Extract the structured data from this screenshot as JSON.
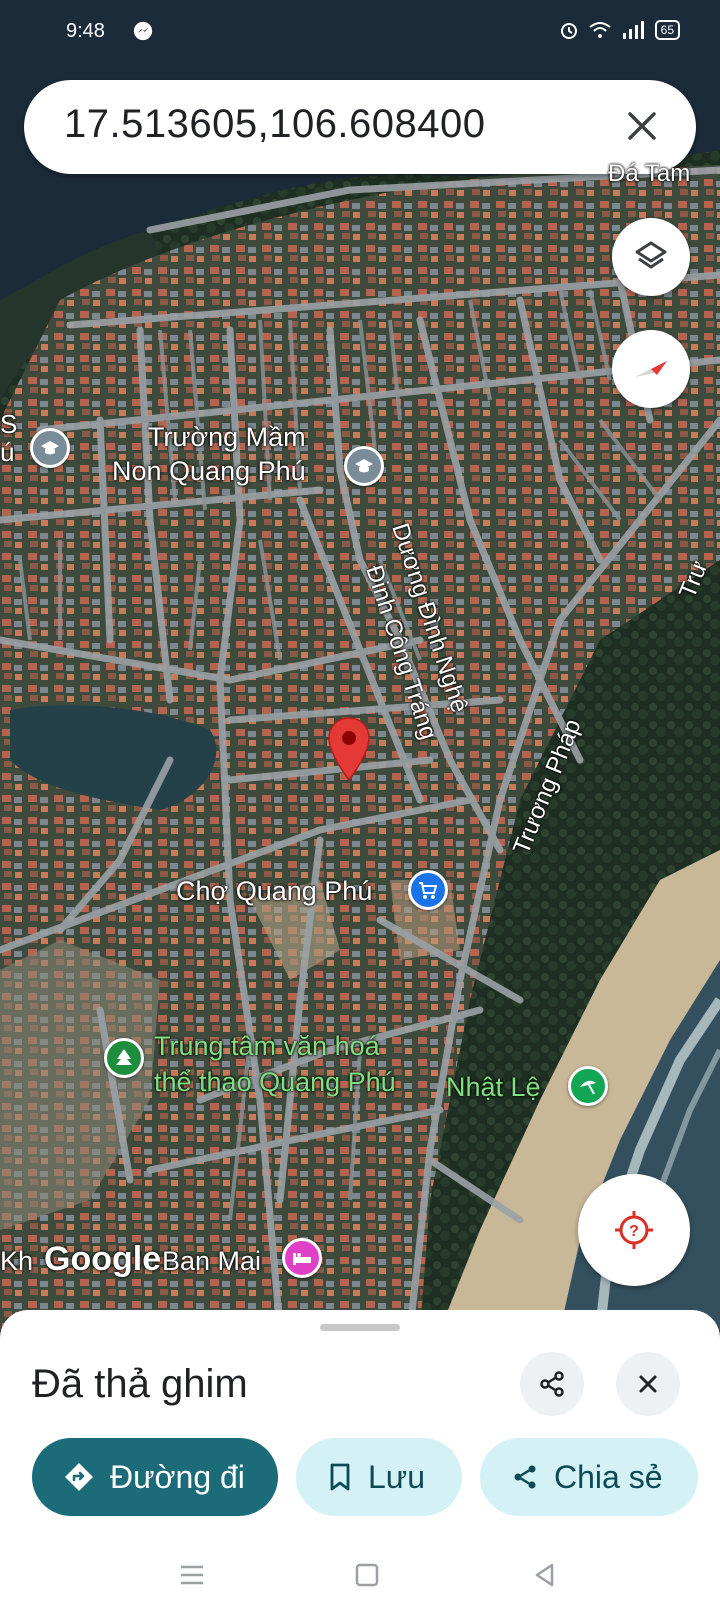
{
  "status": {
    "time": "9:48",
    "battery": "65"
  },
  "search": {
    "query": "17.513605,106.608400"
  },
  "map": {
    "labels": {
      "school_left": "S\nú",
      "school": "Trường Mầm\nNon Quang Phú",
      "street_dinh_nghe": "Dương Đình Nghệ",
      "street_dinh_cong_trang": "Đinh Công Tráng",
      "street_truong_phap": "Trương Pháp",
      "street_top_right": "Trư",
      "area_top_right": "Đá Tam",
      "market": "Chợ Quang Phú",
      "culture_center": "Trung tâm văn hoá\nthể thao Quang Phú",
      "beach": "Nhật Lệ",
      "hotel_prefix": "Kh",
      "hotel": "Ban Mai",
      "google_logo": "Google"
    },
    "colors": {
      "pin": "#e53935",
      "market_poi": "#1a73e8",
      "school_poi": "#7b8c99",
      "park_poi": "#1e8e3e",
      "hotel_poi": "#e040c8",
      "beach_poi": "#12a553"
    }
  },
  "sheet": {
    "title": "Đã thả ghim",
    "actions": {
      "directions": "Đường đi",
      "save": "Lưu",
      "share": "Chia sẻ"
    }
  }
}
